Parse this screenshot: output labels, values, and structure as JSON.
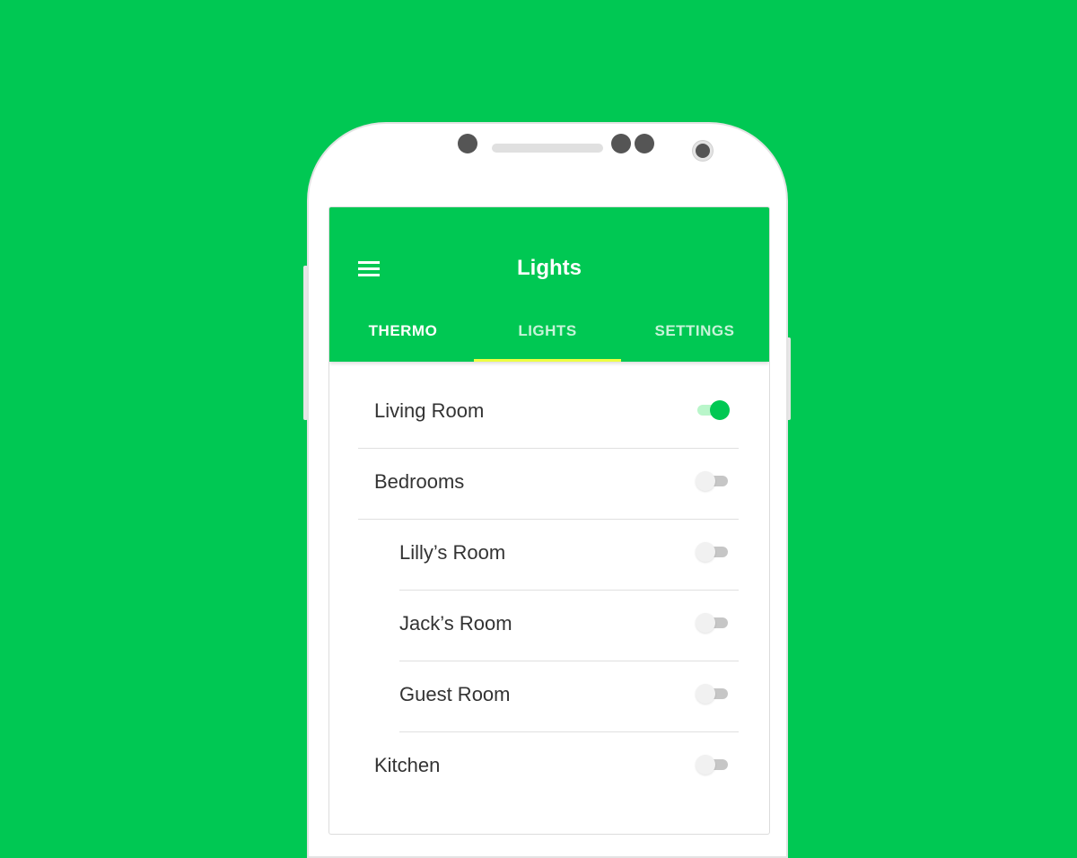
{
  "colors": {
    "background": "#00c853",
    "appbar": "#00c853",
    "tab_indicator": "#eeff41",
    "switch_on": "#00c853",
    "switch_off_track": "#c6c6c6"
  },
  "appbar": {
    "menu_icon": "hamburger-menu-icon",
    "title": "Lights"
  },
  "tabs": [
    {
      "label": "THERMO",
      "selected": false
    },
    {
      "label": "LIGHTS",
      "selected": true
    },
    {
      "label": "SETTINGS",
      "selected": false
    }
  ],
  "rooms": [
    {
      "label": "Living Room",
      "on": true,
      "nested": false
    },
    {
      "label": "Bedrooms",
      "on": false,
      "nested": false
    },
    {
      "label": "Lilly’s Room",
      "on": false,
      "nested": true
    },
    {
      "label": "Jack’s Room",
      "on": false,
      "nested": true
    },
    {
      "label": "Guest Room",
      "on": false,
      "nested": true
    },
    {
      "label": "Kitchen",
      "on": false,
      "nested": false
    }
  ]
}
